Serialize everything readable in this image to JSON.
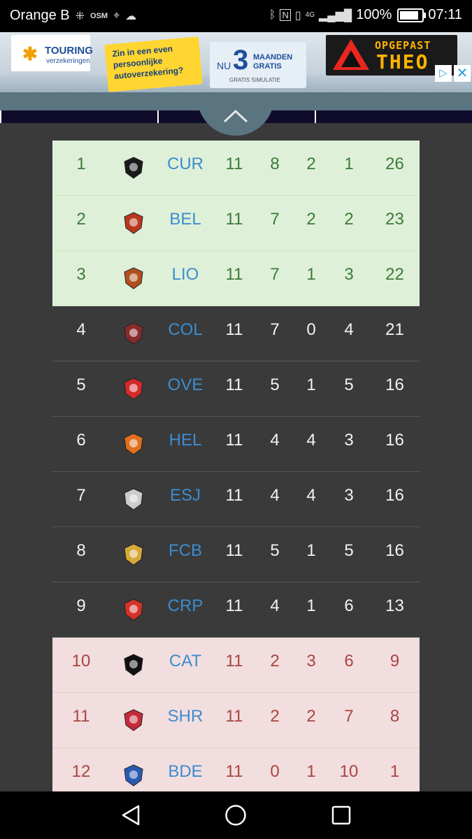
{
  "status": {
    "carrier": "Orange B",
    "network": "4G",
    "battery": "100%",
    "battery_level": 1.0,
    "time": "07:11",
    "icons": [
      "grid-icon",
      "osm-icon",
      "map-icon",
      "cloud-icon",
      "bluetooth-icon",
      "nfc-icon",
      "vibrate-icon",
      "signal-icon"
    ]
  },
  "ad": {
    "brand_line1": "TOURING",
    "brand_line2": "verzekeringen",
    "sticky_text": "Zin in een even persoonlijke autoverzekering?",
    "nu_label": "NU",
    "nu_number": "3",
    "nu_months": "MAANDEN GRATIS",
    "nu_sub": "GRATIS SIMULATIE",
    "sign_line1": "OPGEPAST",
    "sign_line2": "THEO"
  },
  "standings": {
    "rows": [
      {
        "pos": "1",
        "team": "CUR",
        "p": "11",
        "w": "8",
        "d": "2",
        "l": "1",
        "pts": "26",
        "zone": "promo",
        "logo": "cur-logo-icon",
        "color": "#1a1a1a"
      },
      {
        "pos": "2",
        "team": "BEL",
        "p": "11",
        "w": "7",
        "d": "2",
        "l": "2",
        "pts": "23",
        "zone": "promo",
        "logo": "bel-logo-icon",
        "color": "#b8371f"
      },
      {
        "pos": "3",
        "team": "LIO",
        "p": "11",
        "w": "7",
        "d": "1",
        "l": "3",
        "pts": "22",
        "zone": "promo",
        "logo": "lio-logo-icon",
        "color": "#b14f1f"
      },
      {
        "pos": "4",
        "team": "COL",
        "p": "11",
        "w": "7",
        "d": "0",
        "l": "4",
        "pts": "21",
        "zone": "mid",
        "logo": "col-logo-icon",
        "color": "#8a2a2a"
      },
      {
        "pos": "5",
        "team": "OVE",
        "p": "11",
        "w": "5",
        "d": "1",
        "l": "5",
        "pts": "16",
        "zone": "mid",
        "logo": "ove-logo-icon",
        "color": "#d42a2a"
      },
      {
        "pos": "6",
        "team": "HEL",
        "p": "11",
        "w": "4",
        "d": "4",
        "l": "3",
        "pts": "16",
        "zone": "mid",
        "logo": "hel-logo-icon",
        "color": "#e07020"
      },
      {
        "pos": "7",
        "team": "ESJ",
        "p": "11",
        "w": "4",
        "d": "4",
        "l": "3",
        "pts": "16",
        "zone": "mid",
        "logo": "esj-logo-icon",
        "color": "#cccccc"
      },
      {
        "pos": "8",
        "team": "FCB",
        "p": "11",
        "w": "5",
        "d": "1",
        "l": "5",
        "pts": "16",
        "zone": "mid",
        "logo": "fcb-logo-icon",
        "color": "#d4a93a"
      },
      {
        "pos": "9",
        "team": "CRP",
        "p": "11",
        "w": "4",
        "d": "1",
        "l": "6",
        "pts": "13",
        "zone": "mid",
        "logo": "crp-logo-icon",
        "color": "#d4332a"
      },
      {
        "pos": "10",
        "team": "CAT",
        "p": "11",
        "w": "2",
        "d": "3",
        "l": "6",
        "pts": "9",
        "zone": "releg",
        "logo": "cat-logo-icon",
        "color": "#111111"
      },
      {
        "pos": "11",
        "team": "SHR",
        "p": "11",
        "w": "2",
        "d": "2",
        "l": "7",
        "pts": "8",
        "zone": "releg",
        "logo": "shr-logo-icon",
        "color": "#c42a3a"
      },
      {
        "pos": "12",
        "team": "BDE",
        "p": "11",
        "w": "0",
        "d": "1",
        "l": "10",
        "pts": "1",
        "zone": "releg",
        "logo": "bde-logo-icon",
        "color": "#2a5ab0"
      }
    ]
  },
  "nav": {
    "back": "back-icon",
    "home": "home-icon",
    "recents": "recents-icon"
  }
}
